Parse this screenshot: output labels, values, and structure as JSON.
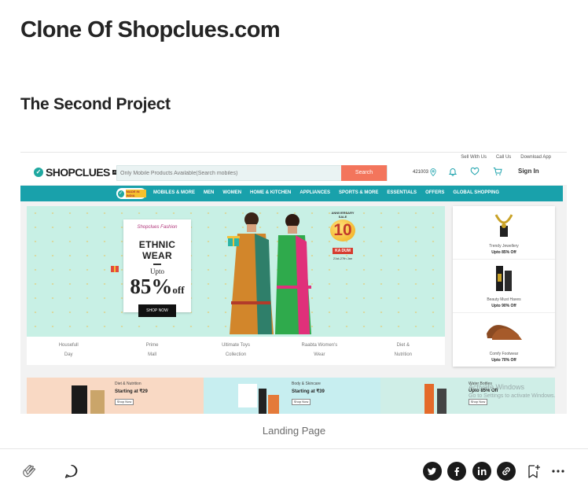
{
  "article": {
    "title": "Clone Of Shopclues.com",
    "subtitle": "The Second Project",
    "caption": "Landing Page"
  },
  "screenshot": {
    "top_links": [
      "Sell With Us",
      "Call Us",
      "Download App"
    ],
    "logo_text": "SHOPCLUES",
    "logo_suffix": ".com",
    "search_placeholder": "Only Mobile Products Available(Search mobiles)",
    "search_button": "Search",
    "pincode": "421003",
    "sign_in": "Sign In",
    "nav_badge": "MADE IN INDIA",
    "nav_items": [
      "MOBILES & MORE",
      "MEN",
      "WOMEN",
      "HOME & KITCHEN",
      "APPLIANCES",
      "SPORTS & MORE",
      "ESSENTIALS",
      "OFFERS",
      "GLOBAL SHOPPING"
    ],
    "banner": {
      "brand": "Shopclues Fashion",
      "title": "ETHNIC WEAR",
      "upto": "Upto",
      "discount": "85%",
      "discount_suffix": "off",
      "cta": "SHOP NOW",
      "anniversary_line1": "ANNIVERSARY",
      "anniversary_line2": "SALE",
      "anniversary_number": "10",
      "ka_dum": "KA DUM",
      "dates": "21st-27th Jan"
    },
    "categories": [
      {
        "line1": "Housefull",
        "line2": "Day"
      },
      {
        "line1": "Prime",
        "line2": "Mall"
      },
      {
        "line1": "Ultimate Toys",
        "line2": "Collection"
      },
      {
        "line1": "Raabta Women's",
        "line2": "Wear"
      },
      {
        "line1": "Diet &",
        "line2": "Nutrition"
      }
    ],
    "side_offers": [
      {
        "label": "Trendy Jewellery",
        "offer": "Upto 85% Off"
      },
      {
        "label": "Beauty Must Haves",
        "offer": "Upto 90% Off"
      },
      {
        "label": "Comfy Footwear",
        "offer": "Upto 70% Off"
      }
    ],
    "promos": [
      {
        "title": "Diet & Nutrition",
        "value": "Starting at ₹29",
        "button": "Shop Now",
        "color": "#f9d9c4"
      },
      {
        "title": "Body & Skincare",
        "value": "Starting at ₹39",
        "button": "Shop Now",
        "color": "#c7eef0"
      },
      {
        "title": "Water Bottles",
        "value": "Upto 85% Off",
        "button": "Shop Now",
        "color": "#cfeee7"
      }
    ],
    "watermark": [
      "Activate Windows",
      "Go to Settings to activate Windows."
    ]
  },
  "footer": {
    "share_icons": [
      "twitter-icon",
      "facebook-icon",
      "linkedin-icon",
      "link-icon"
    ]
  },
  "colors": {
    "teal": "#19a1ab",
    "search_button": "#f3755c",
    "banner_bg": "#c8f0e5"
  }
}
